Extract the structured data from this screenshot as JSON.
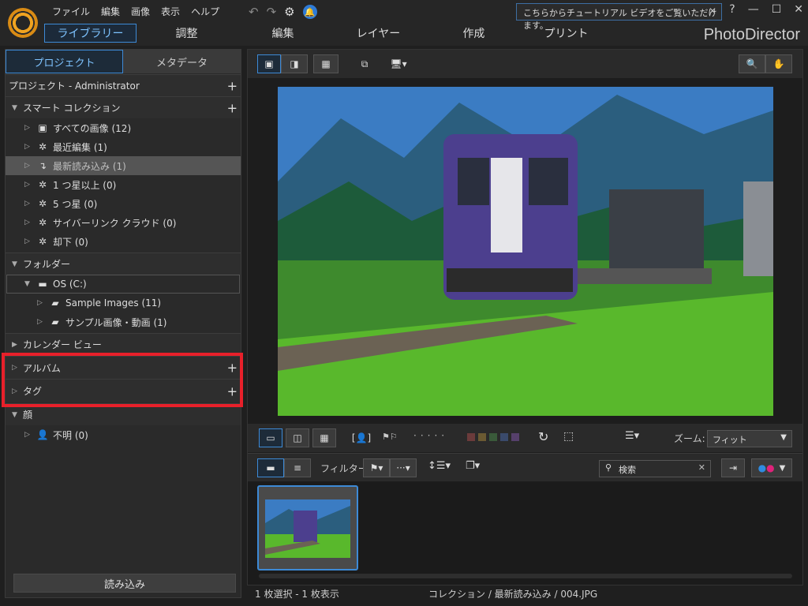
{
  "menus": [
    "ファイル",
    "編集",
    "画像",
    "表示",
    "ヘルプ"
  ],
  "tooltip": "こちらからチュートリアル ビデオをご覧いただけます。",
  "window_controls": [
    "?",
    "—",
    "☐",
    "✕"
  ],
  "tabs": [
    "ライブラリー",
    "調整",
    "編集",
    "レイヤー",
    "作成",
    "プリント"
  ],
  "brand": "PhotoDirector",
  "left_tabs": [
    "プロジェクト",
    "メタデータ"
  ],
  "project_header": "プロジェクト - Administrator",
  "smart_collection": {
    "title": "スマート コレクション",
    "items": [
      {
        "label": "すべての画像 (12)",
        "icon": "all-images-icon"
      },
      {
        "label": "最近編集 (1)",
        "icon": "magic-wand-icon"
      },
      {
        "label": "最新読み込み (1)",
        "icon": "import-arrow-icon"
      },
      {
        "label": "1 つ星以上 (0)",
        "icon": "magic-wand-icon"
      },
      {
        "label": "5 つ星 (0)",
        "icon": "magic-wand-icon"
      },
      {
        "label": "サイバーリンク クラウド (0)",
        "icon": "magic-wand-icon"
      },
      {
        "label": "却下 (0)",
        "icon": "magic-wand-icon"
      }
    ]
  },
  "folder": {
    "title": "フォルダー",
    "drive": "OS (C:)",
    "children": [
      "Sample Images (11)",
      "サンプル画像・動画 (1)"
    ]
  },
  "calendar": "カレンダー ビュー",
  "album": "アルバム",
  "tag": "タグ",
  "face": {
    "title": "顔",
    "unknown": "不明 (0)"
  },
  "import_button": "読み込み",
  "zoom": {
    "label": "ズーム:",
    "value": "フィット"
  },
  "filter_label": "フィルター:",
  "search_placeholder": "検索",
  "status": {
    "left": "1 枚選択 - 1 枚表示",
    "right": "コレクション / 最新読み込み / 004.JPG"
  },
  "colors": {
    "accent": "#3d8ad6",
    "highlight": "#e8202a"
  }
}
